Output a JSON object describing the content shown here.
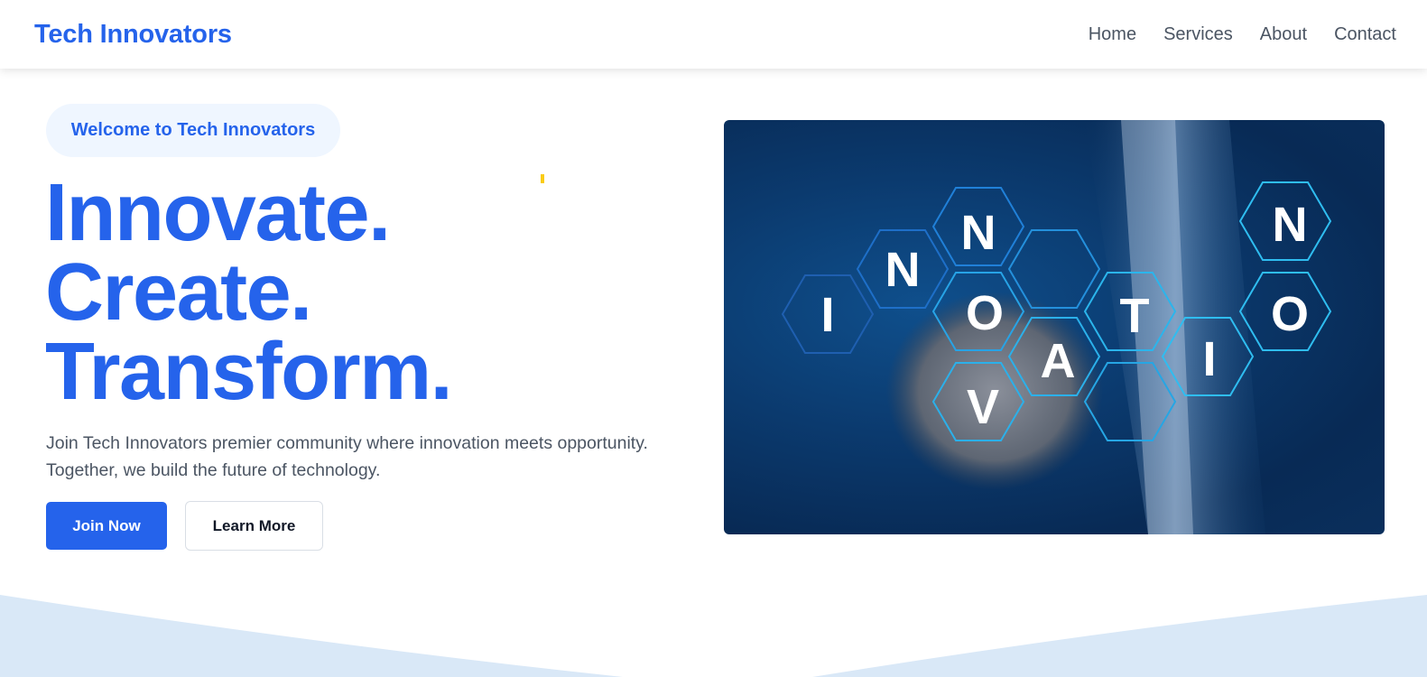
{
  "nav": {
    "brand": "Tech Innovators",
    "links": [
      "Home",
      "Services",
      "About",
      "Contact"
    ]
  },
  "hero": {
    "badge": "Welcome to Tech Innovators",
    "title_lines": [
      "Innovate.",
      "Create.",
      "Transform."
    ],
    "description_lines": [
      "Join Tech Innovators premier community where innovation meets opportunity.",
      "Together, we build the future of technology."
    ],
    "primary_button": "Join Now",
    "secondary_button": "Learn More",
    "image_letters": [
      "I",
      "N",
      "N",
      "O",
      "V",
      "A",
      "T",
      "I",
      "O",
      "N"
    ]
  },
  "colors": {
    "accent": "#2563eb",
    "badge_bg": "#eff6ff",
    "wave": "#d9e8f7"
  }
}
